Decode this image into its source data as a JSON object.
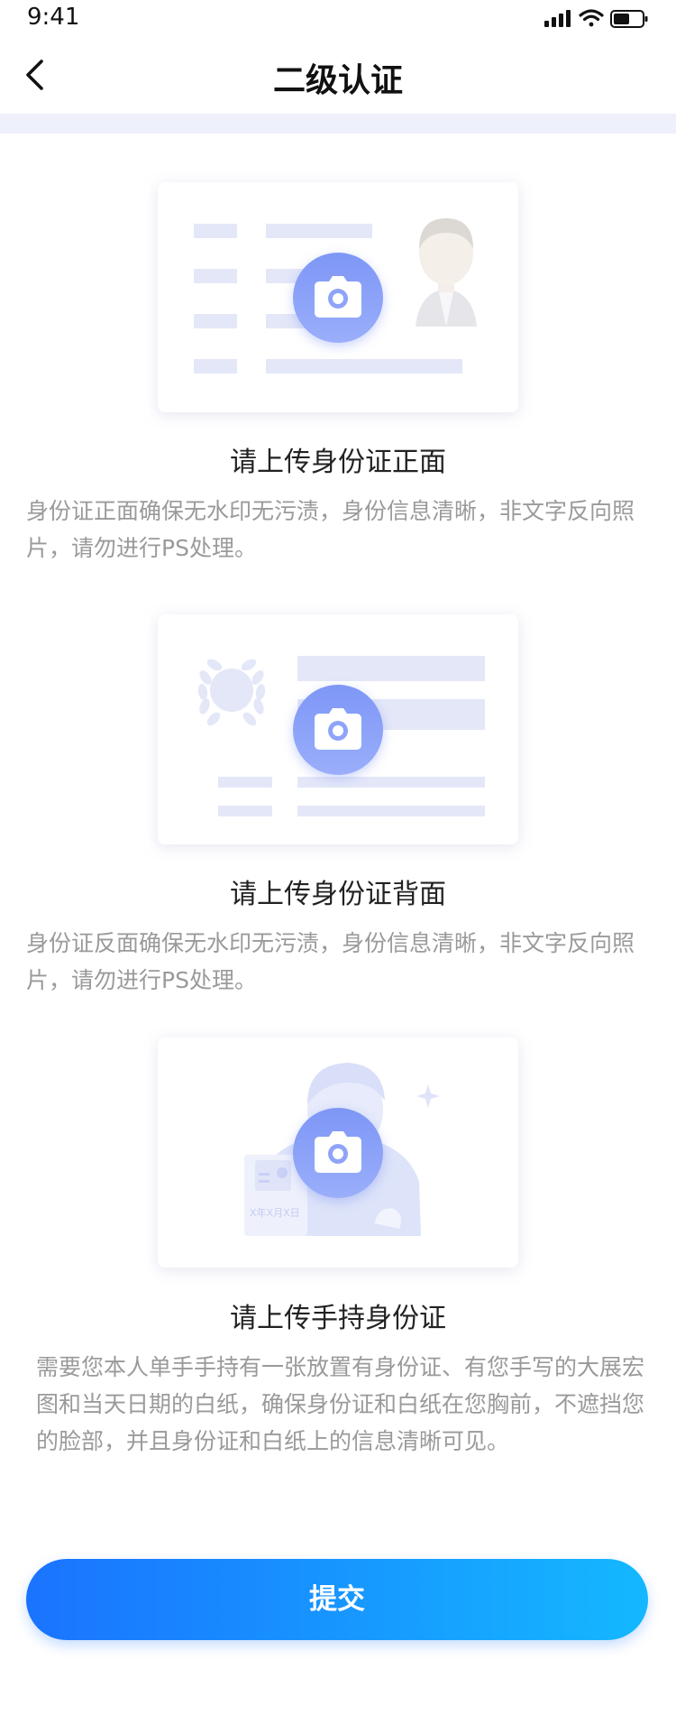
{
  "status_bar": {
    "time": "9:41"
  },
  "nav": {
    "title": "二级认证"
  },
  "sections": [
    {
      "title": "请上传身份证正面",
      "description": "身份证正面确保无水印无污渍，身份信息清晰，非文字反向照片，请勿进行PS处理。"
    },
    {
      "title": "请上传身份证背面",
      "description": "身份证反面确保无水印无污渍，身份信息清晰，非文字反向照片，请勿进行PS处理。"
    },
    {
      "title": "请上传手持身份证",
      "description": "需要您本人单手手持有一张放置有身份证、有您手写的大展宏图和当天日期的白纸，确保身份证和白纸在您胸前，不遮挡您的脸部，并且身份证和白纸上的信息清晰可见。",
      "paper_note": "X年X月X日"
    }
  ],
  "submit": {
    "label": "提交"
  },
  "colors": {
    "accent_start": "#1a73ff",
    "accent_end": "#14b8ff",
    "camera": "#8aa0f8",
    "placeholder_bar": "#e3e7f8"
  },
  "icons": [
    "back-arrow-icon",
    "camera-icon",
    "signal-icon",
    "wifi-icon",
    "battery-icon"
  ]
}
